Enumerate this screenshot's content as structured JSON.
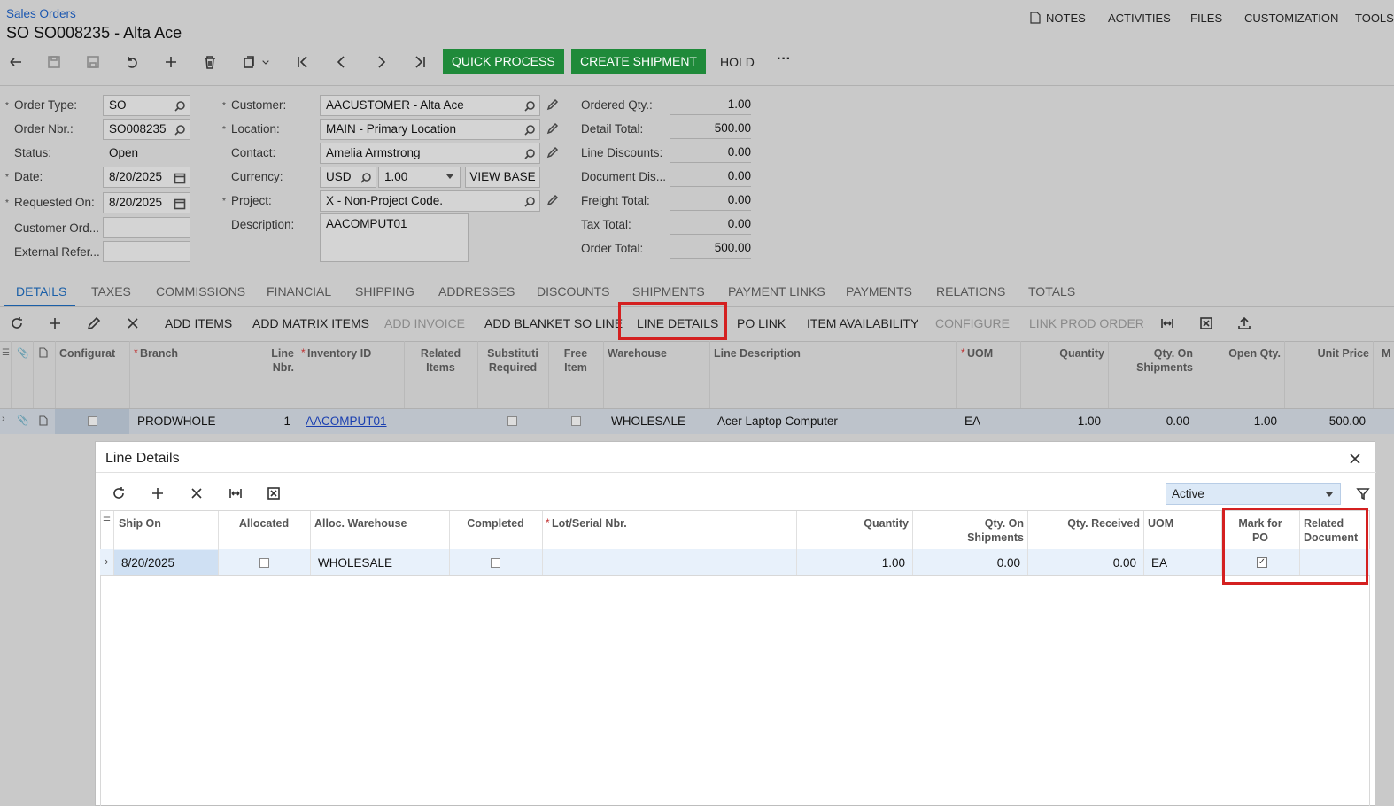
{
  "breadcrumb": "Sales Orders",
  "page_title": "SO SO008235 - Alta Ace",
  "top_menu": [
    "NOTES",
    "ACTIVITIES",
    "FILES",
    "CUSTOMIZATION",
    "TOOLS"
  ],
  "toolbar": {
    "quick_process": "QUICK PROCESS",
    "create_shipment": "CREATE SHIPMENT",
    "hold": "HOLD",
    "more": "···"
  },
  "form": {
    "order_type_label": "Order Type:",
    "order_type": "SO",
    "order_nbr_label": "Order Nbr.:",
    "order_nbr": "SO008235",
    "status_label": "Status:",
    "status": "Open",
    "date_label": "Date:",
    "date": "8/20/2025",
    "requested_on_label": "Requested On:",
    "requested_on": "8/20/2025",
    "customer_ord_label": "Customer Ord...",
    "external_refer_label": "External Refer...",
    "customer_label": "Customer:",
    "customer": "AACUSTOMER - Alta Ace",
    "location_label": "Location:",
    "location": "MAIN - Primary Location",
    "contact_label": "Contact:",
    "contact": "Amelia Armstrong",
    "currency_label": "Currency:",
    "currency": "USD",
    "currency_rate": "1.00",
    "view_base": "VIEW BASE",
    "project_label": "Project:",
    "project": "X - Non-Project Code.",
    "description_label": "Description:",
    "description": "AACOMPUT01"
  },
  "totals": [
    {
      "label": "Ordered Qty.:",
      "value": "1.00"
    },
    {
      "label": "Detail Total:",
      "value": "500.00"
    },
    {
      "label": "Line Discounts:",
      "value": "0.00"
    },
    {
      "label": "Document Dis...",
      "value": "0.00"
    },
    {
      "label": "Freight Total:",
      "value": "0.00"
    },
    {
      "label": "Tax Total:",
      "value": "0.00"
    },
    {
      "label": "Order Total:",
      "value": "500.00"
    }
  ],
  "tabs": [
    "DETAILS",
    "TAXES",
    "COMMISSIONS",
    "FINANCIAL",
    "SHIPPING",
    "ADDRESSES",
    "DISCOUNTS",
    "SHIPMENTS",
    "PAYMENT LINKS",
    "PAYMENTS",
    "RELATIONS",
    "TOTALS"
  ],
  "grid_toolbar": {
    "add_items": "ADD ITEMS",
    "add_matrix_items": "ADD MATRIX ITEMS",
    "add_invoice": "ADD INVOICE",
    "add_blanket": "ADD BLANKET SO LINE",
    "line_details": "LINE DETAILS",
    "po_link": "PO LINK",
    "item_availability": "ITEM AVAILABILITY",
    "configure": "CONFIGURE",
    "link_prod_order": "LINK PROD ORDER"
  },
  "grid_headers": {
    "configurat": "Configurat",
    "branch": "Branch",
    "line_nbr_1": "Line",
    "line_nbr_2": "Nbr.",
    "inventory_id": "Inventory ID",
    "related_1": "Related",
    "related_2": "Items",
    "subst_1": "Substituti",
    "subst_2": "Required",
    "free_1": "Free",
    "free_2": "Item",
    "warehouse": "Warehouse",
    "line_description": "Line Description",
    "uom": "UOM",
    "quantity": "Quantity",
    "qty_ship_1": "Qty. On",
    "qty_ship_2": "Shipments",
    "open_qty": "Open Qty.",
    "unit_price": "Unit Price",
    "m": "M"
  },
  "grid_row": {
    "branch": "PRODWHOLE",
    "line_nbr": "1",
    "inventory_id": "AACOMPUT01",
    "warehouse": "WHOLESALE",
    "line_description": "Acer Laptop Computer",
    "uom": "EA",
    "quantity": "1.00",
    "qty_on_shipments": "0.00",
    "open_qty": "1.00",
    "unit_price": "500.00"
  },
  "dialog": {
    "title": "Line Details",
    "filter_value": "Active",
    "headers": {
      "ship_on": "Ship On",
      "allocated": "Allocated",
      "alloc_warehouse": "Alloc. Warehouse",
      "completed": "Completed",
      "lot_serial": "Lot/Serial Nbr.",
      "quantity": "Quantity",
      "qty_ship_1": "Qty. On",
      "qty_ship_2": "Shipments",
      "qty_received": "Qty. Received",
      "uom": "UOM",
      "mark_po_1": "Mark for",
      "mark_po_2": "PO",
      "related_1": "Related",
      "related_2": "Document"
    },
    "row": {
      "ship_on": "8/20/2025",
      "alloc_warehouse": "WHOLESALE",
      "quantity": "1.00",
      "qty_on_shipments": "0.00",
      "qty_received": "0.00",
      "uom": "EA",
      "mark_for_po": true
    }
  },
  "colors": {
    "accent": "#1a5fa8",
    "green": "#1f8a3a",
    "highlight": "#d42020"
  }
}
